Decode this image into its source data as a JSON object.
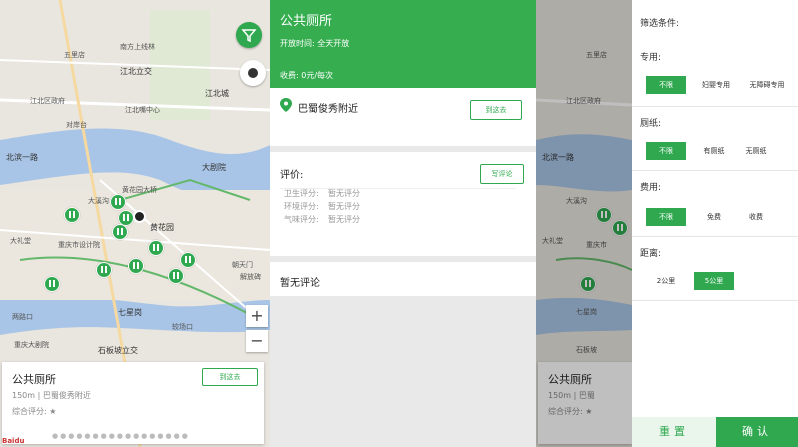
{
  "map_left": {
    "labels": [
      "五里店",
      "南方上线林",
      "江北立交",
      "江北城",
      "江北区政府",
      "江北嘴中心",
      "对岸台",
      "大剧院",
      "北滨一路",
      "黄花园大桥",
      "大溪沟",
      "黄花园",
      "重庆市设计院",
      "大礼堂",
      "解放碑",
      "七星岗",
      "较场口",
      "朝天门",
      "两路口",
      "石板坡立交",
      "重庆大剧院"
    ],
    "zoom_in": "+",
    "zoom_out": "−",
    "card": {
      "title": "公共厕所",
      "subtitle": "150m | 巴蜀俊秀附近",
      "rating": "综合评分: ★",
      "go_label": "到这去"
    }
  },
  "detail": {
    "name": "公共厕所",
    "open_time": "开放时间: 全天开放",
    "fee": "收费: 0元/每次",
    "address": "巴蜀俊秀附近",
    "go_label": "到这去",
    "review_header": "评价:",
    "write_review": "写评论",
    "scores": [
      {
        "label": "卫生评分:",
        "value": "暂无评分"
      },
      {
        "label": "环境评分:",
        "value": "暂无评分"
      },
      {
        "label": "气味评分:",
        "value": "暂无评分"
      }
    ],
    "no_comment": "暂无评论"
  },
  "map_right": {
    "labels": [
      "五里店",
      "江北区政府",
      "大溪沟",
      "北滨一路",
      "大礼堂",
      "重庆市",
      "七星岗",
      "石板坡"
    ],
    "card": {
      "title": "公共厕所",
      "subtitle": "150m | 巴蜀",
      "rating": "综合评分: ★"
    }
  },
  "filter": {
    "title": "筛选条件:",
    "groups": [
      {
        "label": "专用:",
        "options": [
          "不限",
          "妇婴专用",
          "无障碍专用"
        ],
        "selected": 0
      },
      {
        "label": "厕纸:",
        "options": [
          "不限",
          "有厕纸",
          "无厕纸"
        ],
        "selected": 0
      },
      {
        "label": "费用:",
        "options": [
          "不限",
          "免费",
          "收费"
        ],
        "selected": 0
      },
      {
        "label": "距离:",
        "options": [
          "2公里",
          "5公里"
        ],
        "selected": 1
      }
    ],
    "reset": "重置",
    "confirm": "确认"
  },
  "colors": {
    "accent": "#2fa84f",
    "header": "#36ae50"
  }
}
